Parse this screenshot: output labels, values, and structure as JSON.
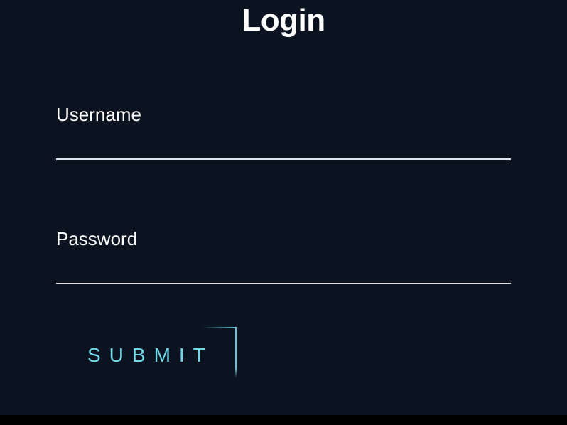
{
  "title": "Login",
  "fields": {
    "username": {
      "label": "Username",
      "value": "",
      "placeholder": ""
    },
    "password": {
      "label": "Password",
      "value": "",
      "placeholder": ""
    }
  },
  "submit_label": "SUBMIT",
  "colors": {
    "background": "#0c1320",
    "text": "#ffffff",
    "accent": "#6fd8e8",
    "underline": "#dfe2e6"
  }
}
